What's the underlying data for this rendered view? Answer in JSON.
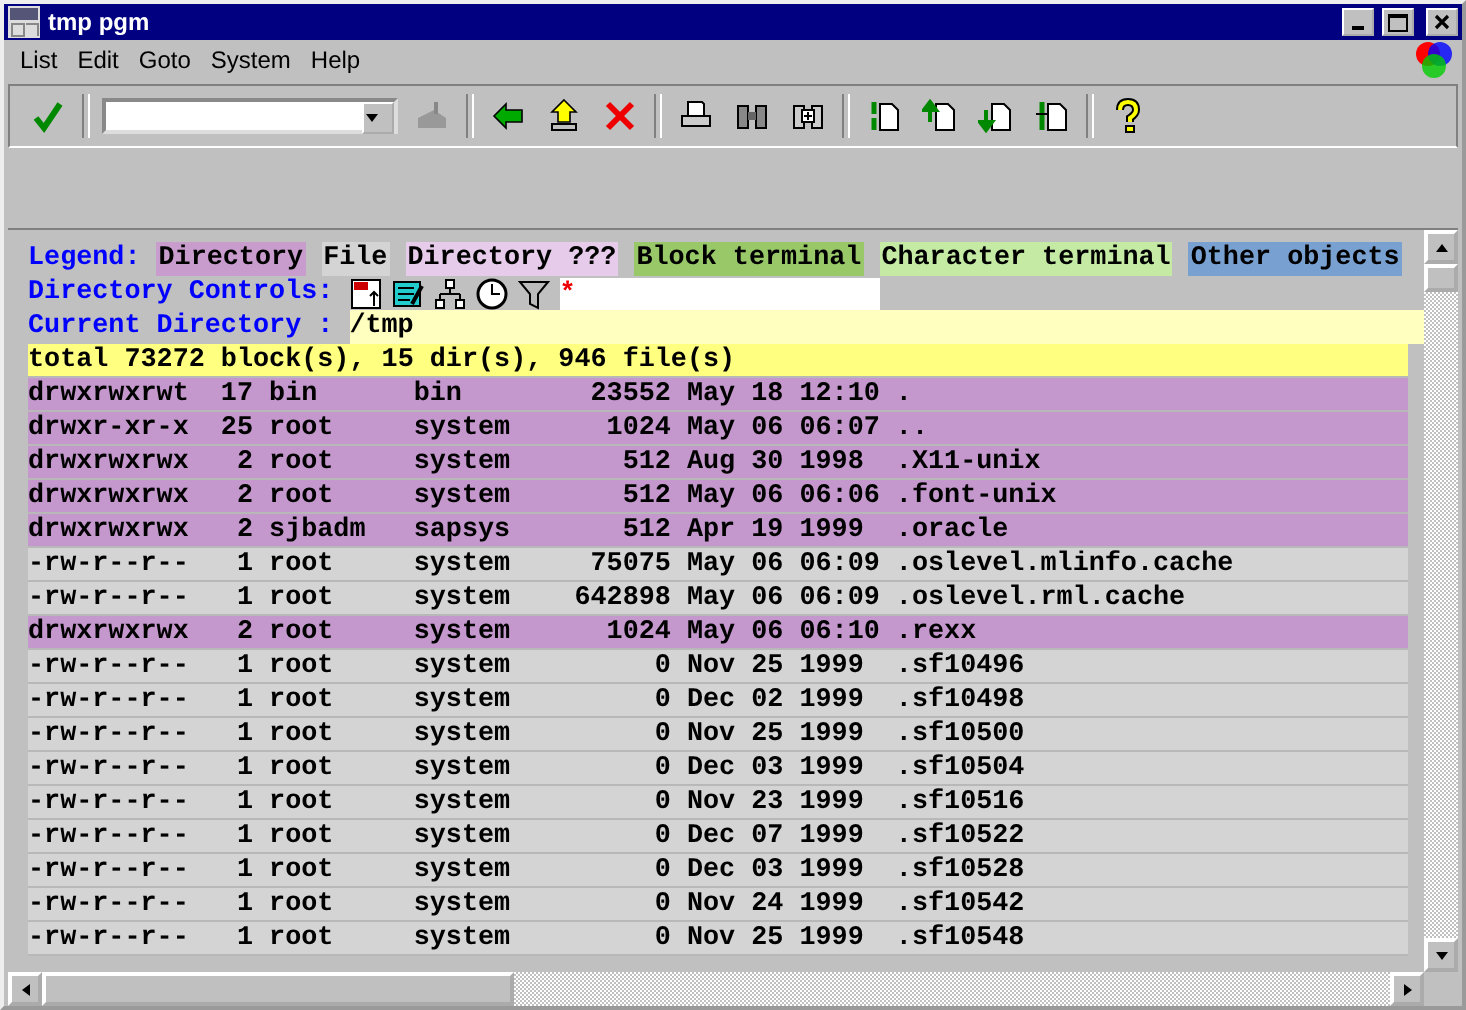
{
  "window": {
    "title": "tmp pgm"
  },
  "menu": [
    "List",
    "Edit",
    "Goto",
    "System",
    "Help"
  ],
  "legend": {
    "label": "Legend:",
    "items": [
      {
        "label": "Directory",
        "color": "#c89ccc"
      },
      {
        "label": "File",
        "color": "#d4d4d4"
      },
      {
        "label": "Directory ???",
        "color": "#e6ccea"
      },
      {
        "label": "Block terminal",
        "color": "#98c868"
      },
      {
        "label": "Character terminal",
        "color": "#c4eaa4"
      },
      {
        "label": "Other objects",
        "color": "#78a0d0"
      }
    ]
  },
  "controls": {
    "label": "Directory Controls:",
    "filter_value": "*"
  },
  "current_directory": {
    "label": "Current Directory :",
    "value": "/tmp"
  },
  "summary": "total 73272 block(s), 15 dir(s), 946 file(s)",
  "lines": [
    {
      "kind": "dir",
      "text": "drwxrwxrwt  17 bin      bin        23552 May 18 12:10 ."
    },
    {
      "kind": "dir",
      "text": "drwxr-xr-x  25 root     system      1024 May 06 06:07 .."
    },
    {
      "kind": "dir",
      "text": "drwxrwxrwx   2 root     system       512 Aug 30 1998  .X11-unix"
    },
    {
      "kind": "dir",
      "text": "drwxrwxrwx   2 root     system       512 May 06 06:06 .font-unix"
    },
    {
      "kind": "dir",
      "text": "drwxrwxrwx   2 sjbadm   sapsys       512 Apr 19 1999  .oracle"
    },
    {
      "kind": "file",
      "text": "-rw-r--r--   1 root     system     75075 May 06 06:09 .oslevel.mlinfo.cache"
    },
    {
      "kind": "file",
      "text": "-rw-r--r--   1 root     system    642898 May 06 06:09 .oslevel.rml.cache"
    },
    {
      "kind": "dir",
      "text": "drwxrwxrwx   2 root     system      1024 May 06 06:10 .rexx"
    },
    {
      "kind": "file",
      "text": "-rw-r--r--   1 root     system         0 Nov 25 1999  .sf10496"
    },
    {
      "kind": "file",
      "text": "-rw-r--r--   1 root     system         0 Dec 02 1999  .sf10498"
    },
    {
      "kind": "file",
      "text": "-rw-r--r--   1 root     system         0 Nov 25 1999  .sf10500"
    },
    {
      "kind": "file",
      "text": "-rw-r--r--   1 root     system         0 Dec 03 1999  .sf10504"
    },
    {
      "kind": "file",
      "text": "-rw-r--r--   1 root     system         0 Nov 23 1999  .sf10516"
    },
    {
      "kind": "file",
      "text": "-rw-r--r--   1 root     system         0 Dec 07 1999  .sf10522"
    },
    {
      "kind": "file",
      "text": "-rw-r--r--   1 root     system         0 Dec 03 1999  .sf10528"
    },
    {
      "kind": "file",
      "text": "-rw-r--r--   1 root     system         0 Nov 24 1999  .sf10542"
    },
    {
      "kind": "file",
      "text": "-rw-r--r--   1 root     system         0 Nov 25 1999  .sf10548"
    }
  ]
}
